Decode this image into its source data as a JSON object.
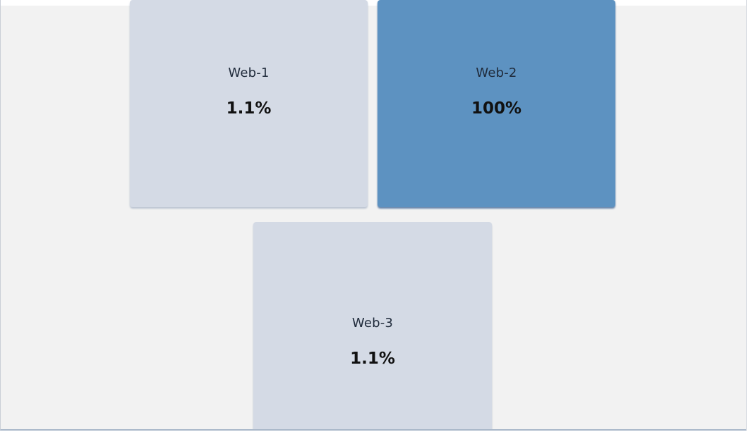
{
  "tiles": [
    {
      "name": "Web-1",
      "value": "1.1%",
      "highlighted": false
    },
    {
      "name": "Web-2",
      "value": "100%",
      "highlighted": true
    },
    {
      "name": "Web-3",
      "value": "1.1%",
      "highlighted": false
    }
  ],
  "colors": {
    "background": "#f2f2f2",
    "tile_default": "#d4dae5",
    "tile_highlighted": "#5d92c1",
    "text_primary": "#111111"
  }
}
